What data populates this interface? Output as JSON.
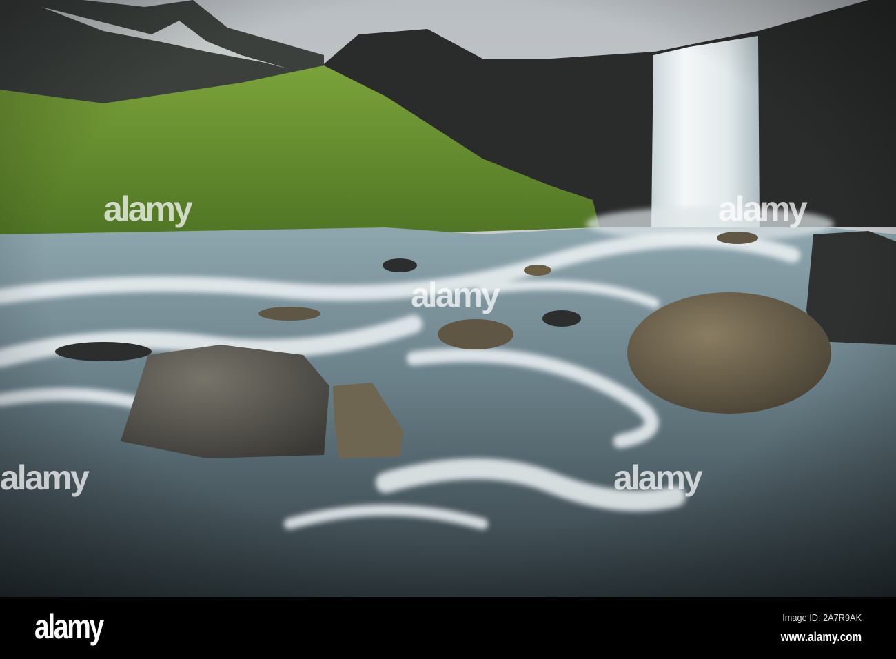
{
  "photo": {
    "subject": "waterfall-river-landscape",
    "watermark": "alamy",
    "colors": {
      "sky": "#c9ccce",
      "cliff": "#2a2c2c",
      "moss": "#6f9a2c",
      "water": "#6f8590",
      "foam": "#e8eef0",
      "boulder": "#6e6450"
    }
  },
  "footer": {
    "logo": "alamy",
    "image_id": "Image ID: 2A7R9AK",
    "website": "www.alamy.com"
  }
}
